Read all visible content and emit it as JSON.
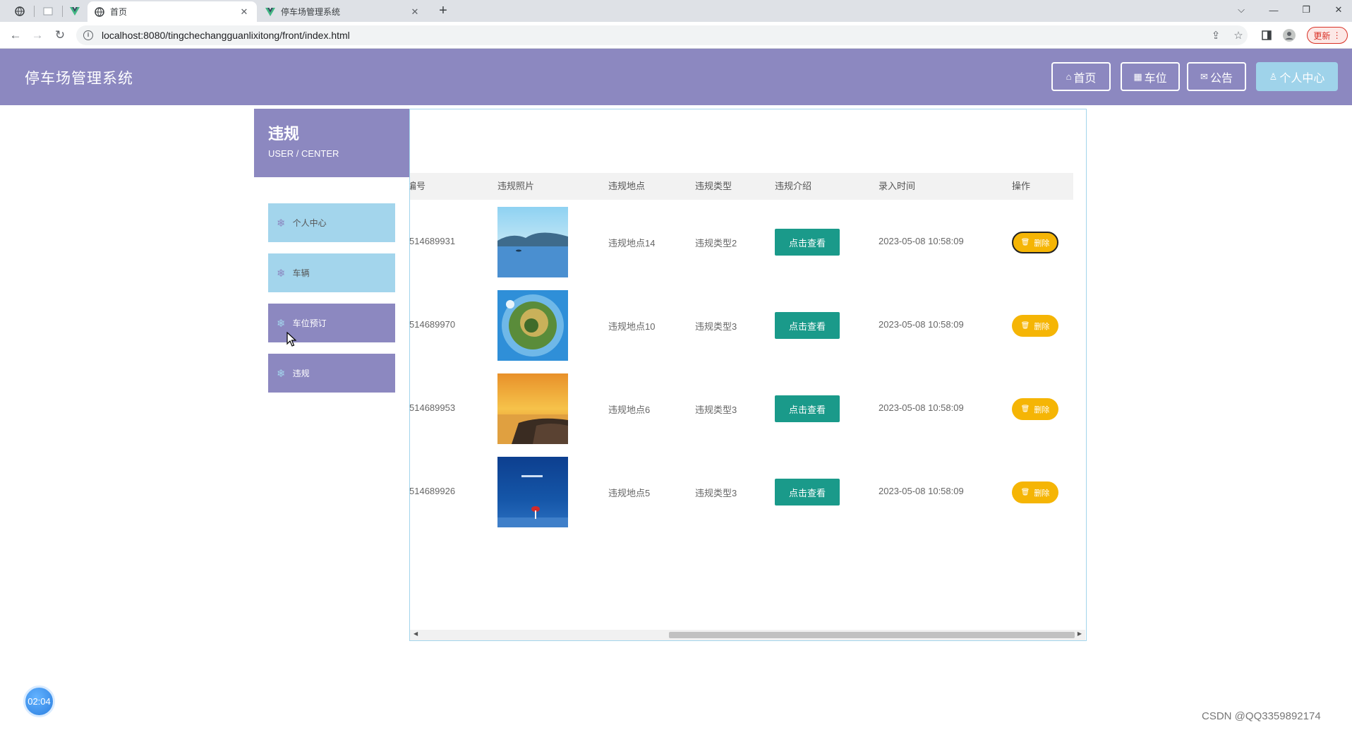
{
  "browser": {
    "tabs": [
      {
        "title": "首页",
        "close": "✕",
        "favicon": "globe-icon"
      },
      {
        "title": "停车场管理系统",
        "close": "✕",
        "favicon": "vue-icon"
      }
    ],
    "url": "localhost:8080/tingchechangguanlixitong/front/index.html",
    "update_label": "更新"
  },
  "site": {
    "title": "停车场管理系统",
    "nav": [
      {
        "label": "首页",
        "icon": "home-icon"
      },
      {
        "label": "车位",
        "icon": "parking-icon"
      },
      {
        "label": "公告",
        "icon": "mail-icon"
      },
      {
        "label": "个人中心",
        "icon": "user-icon"
      }
    ]
  },
  "sidebar": {
    "title": "违规",
    "subtitle": "USER / CENTER",
    "items": [
      {
        "label": "个人中心"
      },
      {
        "label": "车辆"
      },
      {
        "label": "车位预订"
      },
      {
        "label": "违规"
      }
    ]
  },
  "table": {
    "headers": [
      "编号",
      "违规照片",
      "违规地点",
      "违规类型",
      "违规介绍",
      "录入时间",
      "操作"
    ],
    "view_label": "点击查看",
    "delete_label": "删除",
    "rows": [
      {
        "id": "514689931",
        "location": "违规地点14",
        "type": "违规类型2",
        "time": "2023-05-08 10:58:09",
        "photo": "lake-landscape"
      },
      {
        "id": "514689970",
        "location": "违规地点10",
        "type": "违规类型3",
        "time": "2023-05-08 10:58:09",
        "photo": "tiny-planet"
      },
      {
        "id": "514689953",
        "location": "违规地点6",
        "type": "违规类型3",
        "time": "2023-05-08 10:58:09",
        "photo": "sunset-coast"
      },
      {
        "id": "514689926",
        "location": "违规地点5",
        "type": "违规类型3",
        "time": "2023-05-08 10:58:09",
        "photo": "blue-sea-umbrella"
      }
    ]
  },
  "timer": "02:04",
  "watermark": "CSDN @QQ3359892174",
  "colors": {
    "primary": "#8c88c0",
    "secondary": "#a3d5ec",
    "view_button": "#1a9a8a",
    "delete_button": "#f5b505"
  }
}
